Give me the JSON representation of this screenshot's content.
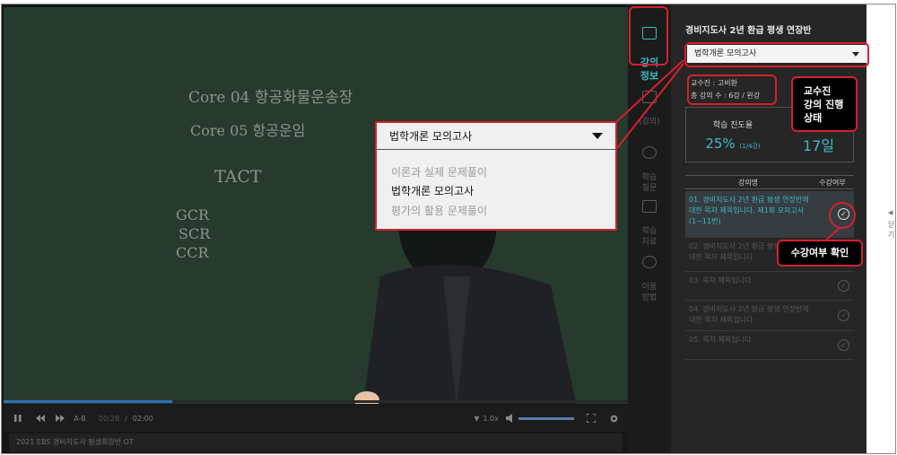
{
  "video": {
    "board_lines": [
      "Core 04  항공화물운송장",
      "Core 05  항공운임",
      "TACT",
      "GCR",
      "SCR",
      "CCR"
    ],
    "time_current": "00:28",
    "time_separator": "/",
    "time_total": "02:00",
    "ab_label": "A-B",
    "speed": "1.0x",
    "progress": 0.27,
    "title": "2021 EBS 경비지도사 평생회원반 OT"
  },
  "nav": {
    "items": [
      {
        "label": "강의\n정보",
        "icon": "play-icon"
      },
      {
        "label": "(강의)",
        "icon": "note-icon"
      },
      {
        "label": "학습\n질문",
        "icon": "chat-icon"
      },
      {
        "label": "학습\n자료",
        "icon": "doc-icon"
      },
      {
        "label": "이용\n방법",
        "icon": "info-icon"
      }
    ]
  },
  "panel": {
    "course_title": "경비지도사 2년 환급 평생 연장반",
    "selected_course": "법학개론 모의고사",
    "professor": "교수진 : 고비환",
    "lecture_count": "총 강의 수 : 6강 / 완강",
    "progress_label": "학습 진도율",
    "progress_value": "25%",
    "progress_detail": "(1/4강)",
    "days_value": "17일",
    "col_name": "강의명",
    "col_status": "수강여부",
    "lectures": [
      {
        "title": "01. 경비지도사 2년 환급 평생 연장반에 대한 목차 제목입니다. 제1회 모의고사 (1~11번)",
        "check": "✓"
      },
      {
        "title": "02. 경비지도사 2년 환급 평생 연장반에 대한 목차 제목입니다.",
        "check": "✓"
      },
      {
        "title": "03. 목차 제목입니다.",
        "check": "✓"
      },
      {
        "title": "04. 경비지도사 2년 환급 평생 연장반에 대한 목차 제목입니다.",
        "check": "✓"
      },
      {
        "title": "05. 목차 제목입니다.",
        "check": "✓"
      }
    ],
    "collapse_label": "닫기"
  },
  "dropdown_zoom": {
    "selected": "법학개론 모의고사",
    "options": [
      "이론과 실제 문제풀이",
      "법학개론 모의고사",
      "평가의 활용 문제풀이"
    ]
  },
  "callouts": {
    "instructor_status": "교수진\n강의 진행\n상태",
    "attendance_check": "수강여부 확인"
  },
  "colors": {
    "accent": "#3fb9c4",
    "annotation": "#d5202e",
    "board": "#263a2e"
  }
}
